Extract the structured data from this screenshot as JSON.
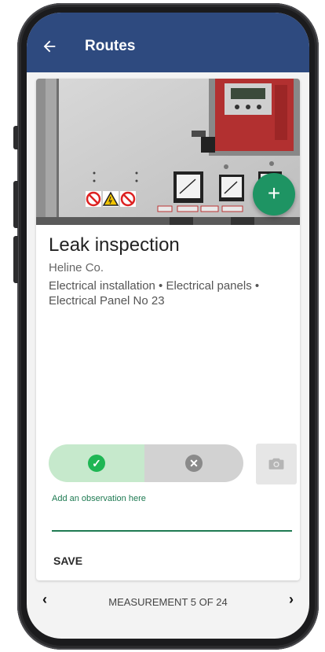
{
  "appbar": {
    "title": "Routes",
    "back_icon": "arrow-left-icon"
  },
  "item": {
    "title": "Leak inspection",
    "company": "Heline Co.",
    "breadcrumb": "Electrical installation • Electrical panels • Electrical Panel No 23",
    "photo_icons": [
      "no-entry-sign",
      "warning-triangle-sign",
      "no-smoking-sign"
    ]
  },
  "fab": {
    "label": "+",
    "icon": "plus-icon"
  },
  "toggle": {
    "pass_icon": "check-circle-icon",
    "fail_icon": "x-circle-icon",
    "selected": "pass"
  },
  "camera": {
    "icon": "camera-icon"
  },
  "observation": {
    "label": "Add an observation here",
    "value": ""
  },
  "actions": {
    "save_label": "SAVE"
  },
  "navigation": {
    "prev_icon": "chevron-left-icon",
    "next_icon": "chevron-right-icon",
    "counter": "MEASUREMENT 5 OF 24"
  },
  "colors": {
    "appbar": "#2e4a7f",
    "accent": "#1e9463",
    "pass": "#1fb654",
    "pass_bg": "#c6e9cc",
    "fail": "#8a8a8a"
  }
}
